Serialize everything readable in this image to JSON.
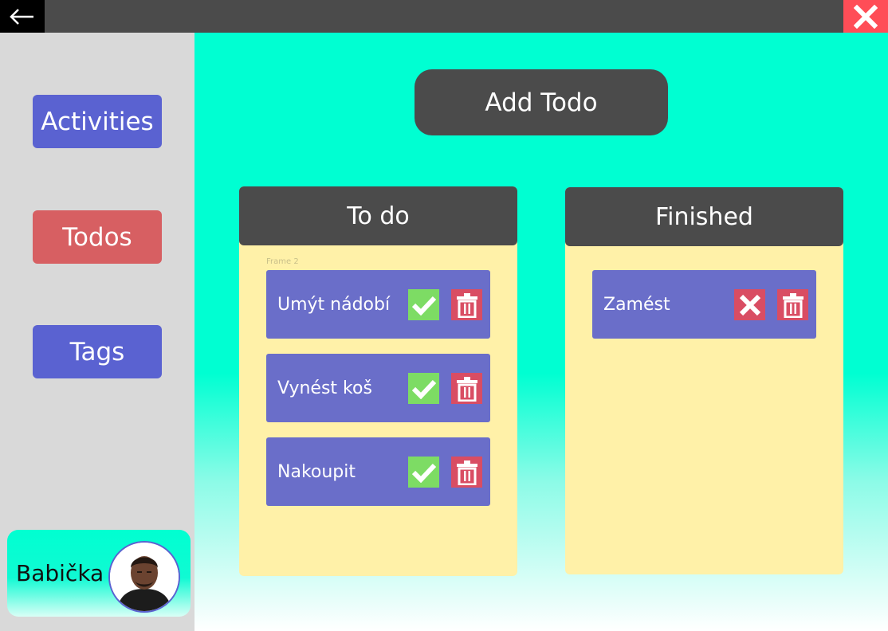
{
  "window": {
    "back_icon": "arrow-left-icon",
    "close_icon": "close-icon"
  },
  "sidebar": {
    "items": [
      {
        "label": "Activities"
      },
      {
        "label": "Todos"
      },
      {
        "label": "Tags"
      }
    ],
    "profile": {
      "name": "Babička",
      "avatar_icon": "avatar"
    }
  },
  "main": {
    "add_todo_label": "Add Todo",
    "columns": {
      "todo": {
        "title": "To do",
        "frame_label": "Frame 2",
        "items": [
          {
            "label": "Umýt nádobí",
            "action_icon": "check-icon"
          },
          {
            "label": "Vynést koš",
            "action_icon": "check-icon"
          },
          {
            "label": "Nakoupit",
            "action_icon": "check-icon"
          }
        ]
      },
      "finished": {
        "title": "Finished",
        "items": [
          {
            "label": "Zamést",
            "action_icon": "x-icon"
          }
        ]
      }
    }
  },
  "colors": {
    "accent_teal": "#00ffd2",
    "nav_blue": "#5a62d1",
    "nav_active_red": "#d75f62",
    "card_blue": "#6a6ec9",
    "column_yellow": "#fff1a8",
    "dark_header": "#4b4b4b",
    "check_green": "#7ddc64",
    "delete_red": "#d94d63",
    "close_red": "#ff4d57"
  }
}
